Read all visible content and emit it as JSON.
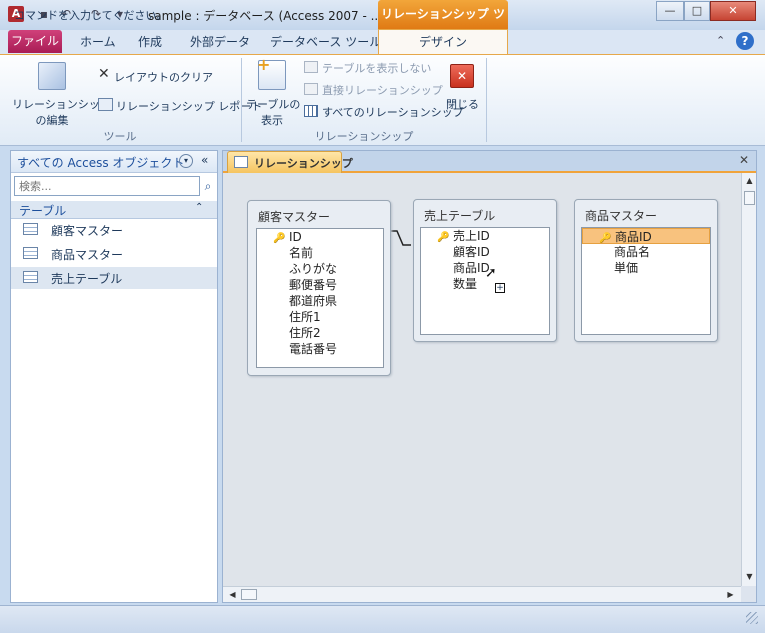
{
  "app": {
    "icon_letter": "A",
    "title": "sample : データベース (Access 2007 - ...",
    "context_tab_header": "リレーションシップ ツール",
    "window_buttons": {
      "minimize": "—",
      "maximize": "□",
      "close": "✕"
    }
  },
  "tabs": {
    "file": "ファイル",
    "home": "ホーム",
    "create": "作成",
    "external": "外部データ",
    "dbtools": "データベース ツール",
    "design": "デザイン"
  },
  "ribbon": {
    "tools_group": {
      "edit_relationships": "リレーションシップ\nの編集",
      "edit_line1": "リレーションシップ",
      "edit_line2": "の編集",
      "clear_layout": "レイアウトのクリア",
      "relationship_report": "リレーションシップ レポート",
      "group_name": "ツール"
    },
    "relationships_group": {
      "show_table_line1": "テーブルの",
      "show_table_line2": "表示",
      "hide_table": "テーブルを表示しない",
      "direct_relationships": "直接リレーションシップ",
      "all_relationships": "すべてのリレーションシップ",
      "close": "閉じる",
      "group_name": "リレーションシップ"
    }
  },
  "nav": {
    "title": "すべての Access オブジェクト",
    "search_placeholder": "検索...",
    "group": "テーブル",
    "items": [
      "顧客マスター",
      "商品マスター",
      "売上テーブル"
    ],
    "selected_index": 2
  },
  "document": {
    "tab_label": "リレーションシップ",
    "tables": [
      {
        "name": "顧客マスター",
        "fields": [
          "ID",
          "名前",
          "ふりがな",
          "郵便番号",
          "都道府県",
          "住所1",
          "住所2",
          "電話番号"
        ],
        "key_field": "ID"
      },
      {
        "name": "売上テーブル",
        "fields": [
          "売上ID",
          "顧客ID",
          "商品ID",
          "数量"
        ],
        "key_field": "売上ID"
      },
      {
        "name": "商品マスター",
        "fields": [
          "商品ID",
          "商品名",
          "単価"
        ],
        "key_field": "商品ID",
        "selected_field": "商品ID"
      }
    ]
  },
  "status": {
    "text": "コマンドを入力してください。"
  },
  "colors": {
    "accent_file_tab": "#b8245e",
    "context_orange": "#e88a22",
    "selection": "#f8c27e"
  }
}
